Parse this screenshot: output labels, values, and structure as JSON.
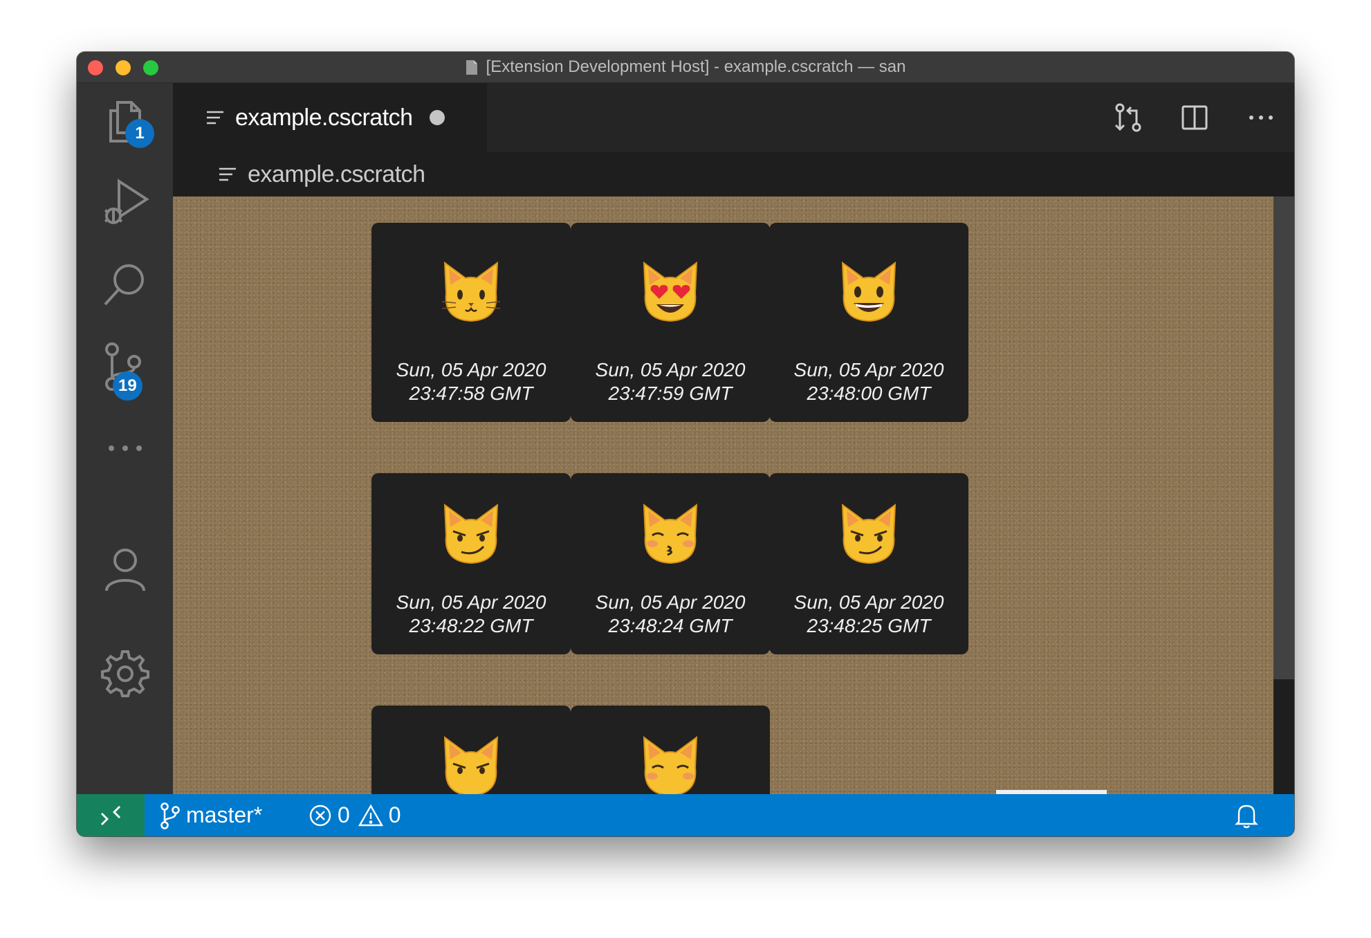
{
  "window": {
    "title": "[Extension Development Host] - example.cscratch — san"
  },
  "activity_bar": {
    "explorer_badge": "1",
    "source_control_badge": "19"
  },
  "editor": {
    "tab_label": "example.cscratch",
    "breadcrumb_label": "example.cscratch"
  },
  "cards": [
    {
      "icon": "cat-face",
      "date_line1": "Sun, 05 Apr 2020",
      "date_line2": "23:47:58 GMT"
    },
    {
      "icon": "heart-eyes-cat",
      "date_line1": "Sun, 05 Apr 2020",
      "date_line2": "23:47:59 GMT"
    },
    {
      "icon": "grinning-cat",
      "date_line1": "Sun, 05 Apr 2020",
      "date_line2": "23:48:00 GMT"
    },
    {
      "icon": "smirk-cat",
      "date_line1": "Sun, 05 Apr 2020",
      "date_line2": "23:48:22 GMT"
    },
    {
      "icon": "kissing-cat",
      "date_line1": "Sun, 05 Apr 2020",
      "date_line2": "23:48:24 GMT"
    },
    {
      "icon": "smirk-cat",
      "date_line1": "Sun, 05 Apr 2020",
      "date_line2": "23:48:25 GMT"
    },
    {
      "icon": "smirk-cat"
    },
    {
      "icon": "kissing-cat"
    }
  ],
  "status_bar": {
    "branch": "master*",
    "errors": "0",
    "warnings": "0"
  },
  "colors": {
    "status_bar": "#007acc",
    "remote_indicator": "#16825d",
    "badge": "#0e70c0",
    "corkboard": "#8c7452",
    "card": "#202020"
  }
}
